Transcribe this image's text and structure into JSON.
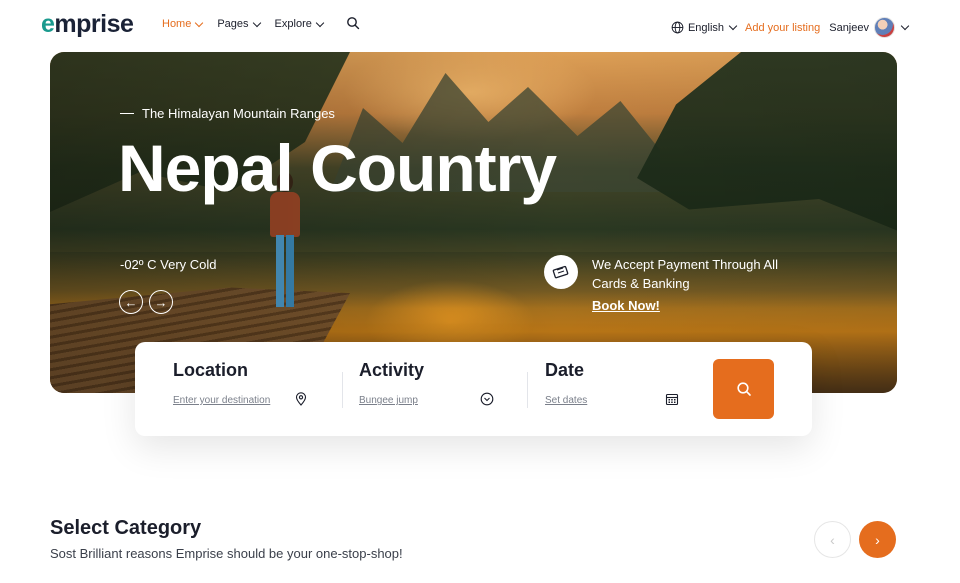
{
  "header": {
    "logo_first": "e",
    "logo_rest": "mprise",
    "nav": [
      {
        "label": "Home"
      },
      {
        "label": "Pages"
      },
      {
        "label": "Explore"
      }
    ],
    "language": "English",
    "add_listing": "Add your listing",
    "user_name": "Sanjeev"
  },
  "hero": {
    "subtitle": "The Himalayan Mountain Ranges",
    "title": "Nepal Country",
    "temperature": "-02º C Very Cold",
    "payment_text": "We Accept Payment Through All Cards & Banking",
    "book_now": "Book Now!"
  },
  "search": {
    "location_label": "Location",
    "location_placeholder": "Enter your destination",
    "activity_label": "Activity",
    "activity_value": "Bungee jump",
    "date_label": "Date",
    "date_placeholder": "Set dates"
  },
  "category": {
    "title": "Select Category",
    "subtitle": "Sost Brilliant reasons Emprise should be your one-stop-shop!"
  },
  "colors": {
    "accent": "#e56d1e",
    "logo_teal": "#1a9a8e",
    "text_dark": "#1b1e2b"
  },
  "icons": {
    "search": "search-icon",
    "globe": "globe-icon",
    "map_pin": "map-pin-icon",
    "chevron_circle": "chevron-circle-icon",
    "calendar": "calendar-icon",
    "ticket": "ticket-icon",
    "arrow_left": "arrow-left-icon",
    "arrow_right": "arrow-right-icon"
  }
}
